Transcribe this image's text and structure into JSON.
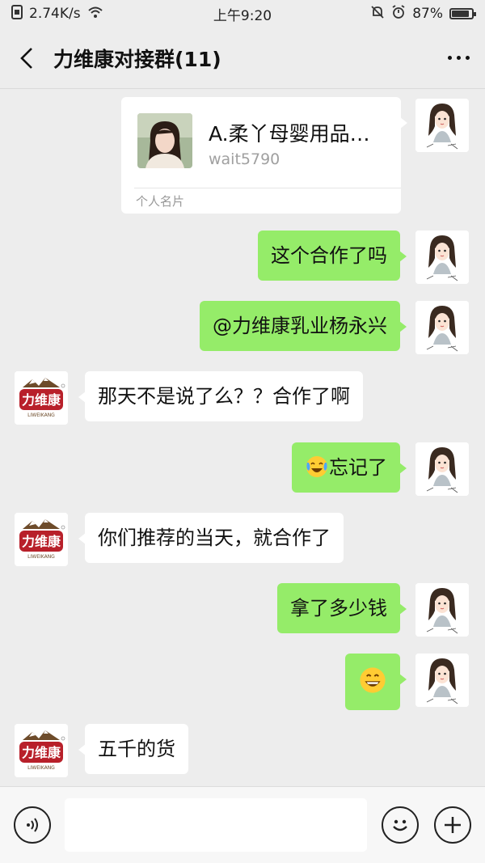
{
  "status_bar": {
    "network_speed": "2.74K/s",
    "time": "上午9:20",
    "battery": "87%",
    "battery_level": 0.87
  },
  "header": {
    "title": "力维康对接群(11)"
  },
  "messages": [
    {
      "type": "card",
      "side": "right",
      "name": "A.柔丫母婴用品…",
      "id": "wait5790",
      "footer": "个人名片"
    },
    {
      "type": "text",
      "side": "right",
      "text": "这个合作了吗"
    },
    {
      "type": "text",
      "side": "right",
      "text": "@力维康乳业杨永兴"
    },
    {
      "type": "text",
      "side": "left",
      "text": "那天不是说了么？？合作了啊"
    },
    {
      "type": "text",
      "side": "right",
      "emoji": "laugh-cry-emoji",
      "text": "忘记了"
    },
    {
      "type": "text",
      "side": "left",
      "text": "你们推荐的当天，就合作了"
    },
    {
      "type": "text",
      "side": "right",
      "text": "拿了多少钱"
    },
    {
      "type": "text",
      "side": "right",
      "emoji": "grin-emoji",
      "text": ""
    },
    {
      "type": "text",
      "side": "left",
      "text": "五千的货"
    }
  ],
  "brand_logo_text": "力维康",
  "brand_logo_sub": "LIWEIKANG",
  "input_bar": {
    "voice_icon": "voice-icon",
    "emoji_icon": "emoji-face-icon",
    "plus_icon": "plus-icon"
  },
  "colors": {
    "background": "#ededed",
    "green_bubble": "#95ec69",
    "white_bubble": "#ffffff",
    "brand_red": "#b8202a"
  }
}
